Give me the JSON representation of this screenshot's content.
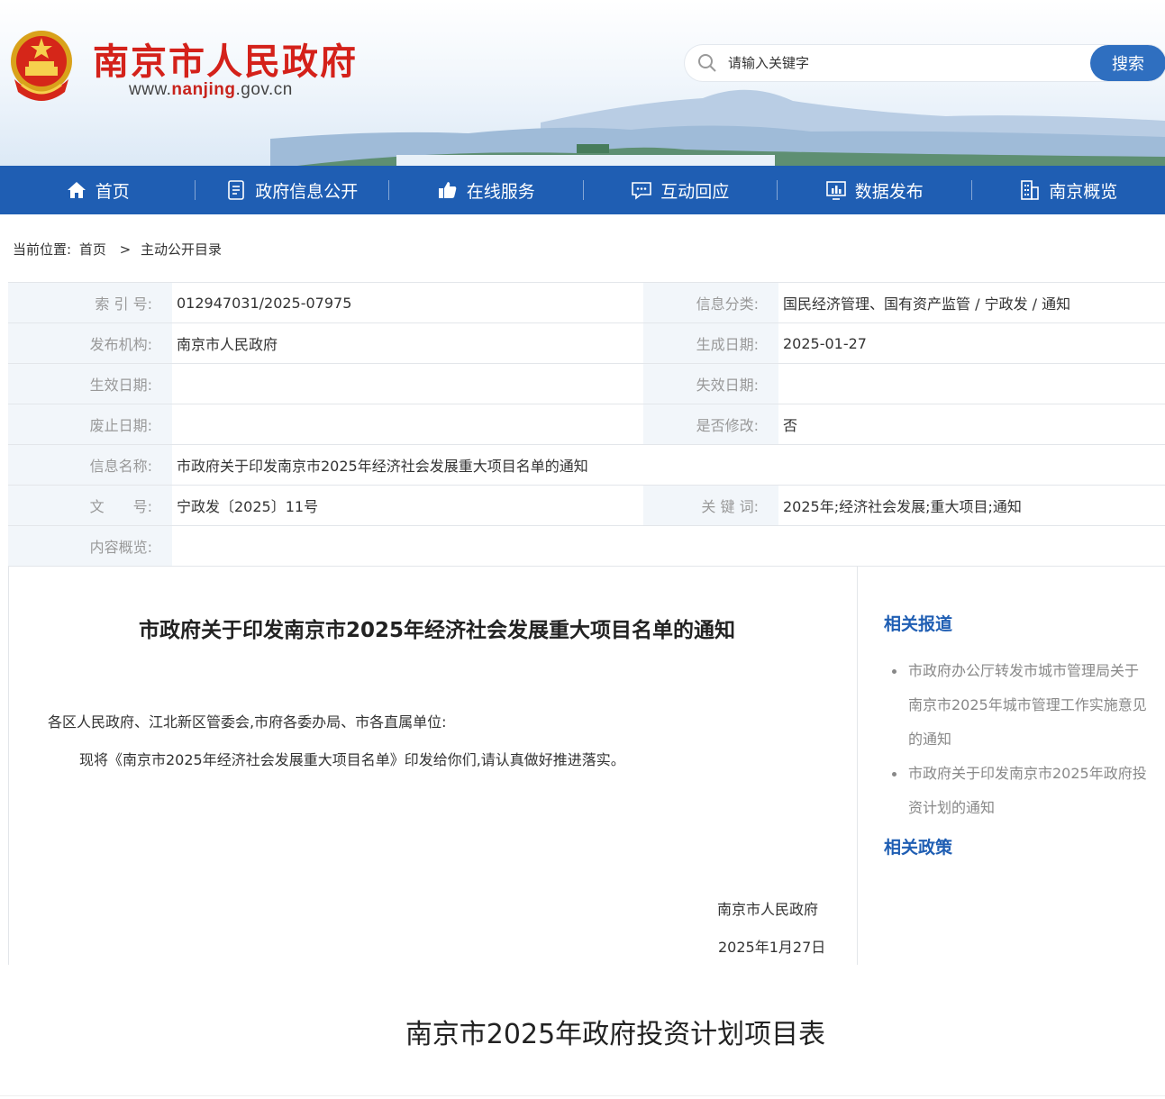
{
  "header": {
    "site_title": "南京市人民政府",
    "url_prefix": "www.",
    "url_domain": "nanjing",
    "url_suffix": ".gov.cn",
    "emblem_icon": "national-emblem-icon"
  },
  "search": {
    "placeholder": "请输入关键字",
    "button_label": "搜索",
    "icon": "search-icon"
  },
  "nav": {
    "items": [
      {
        "label": "首页",
        "icon": "home-icon"
      },
      {
        "label": "政府信息公开",
        "icon": "document-icon"
      },
      {
        "label": "在线服务",
        "icon": "thumbs-up-icon"
      },
      {
        "label": "互动回应",
        "icon": "chat-icon"
      },
      {
        "label": "数据发布",
        "icon": "chart-icon"
      },
      {
        "label": "南京概览",
        "icon": "building-icon"
      }
    ]
  },
  "breadcrumb": {
    "prefix": "当前位置:",
    "home": "首页",
    "separator": ">",
    "current": "主动公开目录"
  },
  "info": {
    "index_no_label": "索 引 号:",
    "index_no": "012947031/2025-07975",
    "category_label": "信息分类:",
    "category": "国民经济管理、国有资产监管 / 宁政发 / 通知",
    "publisher_label": "发布机构:",
    "publisher": "南京市人民政府",
    "created_label": "生成日期:",
    "created": "2025-01-27",
    "effective_label": "生效日期:",
    "effective": "",
    "expiry_label": "失效日期:",
    "expiry": "",
    "repealed_label": "废止日期:",
    "repealed": "",
    "modified_label": "是否修改:",
    "modified": "否",
    "name_label": "信息名称:",
    "name": "市政府关于印发南京市2025年经济社会发展重大项目名单的通知",
    "doc_no_label": "文　　号:",
    "doc_no": "宁政发〔2025〕11号",
    "keywords_label": "关 键 词:",
    "keywords": "2025年;经济社会发展;重大项目;通知",
    "summary_label": "内容概览:",
    "summary": ""
  },
  "article": {
    "title": "市政府关于印发南京市2025年经济社会发展重大项目名单的通知",
    "salutation": "各区人民政府、江北新区管委会,市府各委办局、市各直属单位:",
    "body": "现将《南京市2025年经济社会发展重大项目名单》印发给你们,请认真做好推进落实。",
    "signer": "南京市人民政府",
    "date": "2025年1月27日"
  },
  "sidebar": {
    "related_reports_title": "相关报道",
    "related_reports": [
      "市政府办公厅转发市城市管理局关于南京市2025年城市管理工作实施意见的通知",
      "市政府关于印发南京市2025年政府投资计划的通知"
    ],
    "related_policies_title": "相关政策"
  },
  "caption": "南京市2025年政府投资计划项目表",
  "colors": {
    "nav_bg": "#1f5eb3",
    "title_red": "#d4211a",
    "link_blue": "#1f5eb3",
    "label_bg": "#f2f6fa"
  }
}
